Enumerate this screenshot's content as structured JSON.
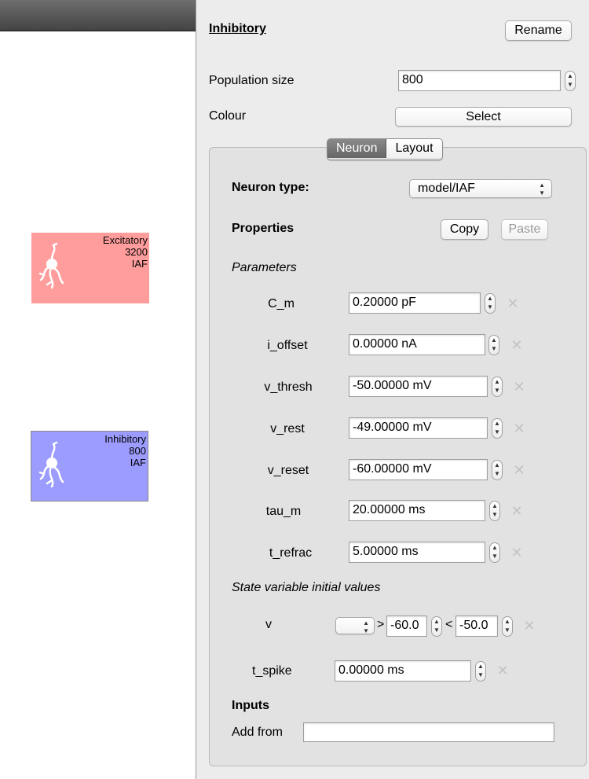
{
  "canvas": {
    "populations": [
      {
        "name": "Excitatory",
        "size": "3200",
        "model": "IAF",
        "color": "#ff9d9d"
      },
      {
        "name": "Inhibitory",
        "size": "800",
        "model": "IAF",
        "color": "#9c9cff"
      }
    ]
  },
  "panel": {
    "title": "Inhibitory",
    "rename_label": "Rename",
    "population_size_label": "Population size",
    "population_size_value": "800",
    "colour_label": "Colour",
    "select_label": "Select",
    "tabs": [
      "Neuron",
      "Layout"
    ],
    "active_tab": "Neuron",
    "neuron_type_label": "Neuron type:",
    "neuron_type_value": "model/IAF",
    "properties_label": "Properties",
    "copy_label": "Copy",
    "paste_label": "Paste",
    "parameters_heading": "Parameters",
    "parameters": [
      {
        "name": "C_m",
        "value": "0.20000 pF"
      },
      {
        "name": "i_offset",
        "value": "0.00000 nA"
      },
      {
        "name": "v_thresh",
        "value": "-50.00000 mV"
      },
      {
        "name": "v_rest",
        "value": "-49.00000 mV"
      },
      {
        "name": "v_reset",
        "value": "-60.00000 mV"
      },
      {
        "name": "tau_m",
        "value": "20.00000 ms"
      },
      {
        "name": "t_refrac",
        "value": "5.00000 ms"
      }
    ],
    "state_heading": "State variable initial values",
    "state_v": {
      "name": "v",
      "gt": ">",
      "min": "-60.0",
      "lt": "<",
      "max": "-50.0"
    },
    "state_t_spike": {
      "name": "t_spike",
      "value": "0.00000 ms"
    },
    "inputs_heading": "Inputs",
    "add_from_label": "Add from",
    "add_from_value": ""
  }
}
